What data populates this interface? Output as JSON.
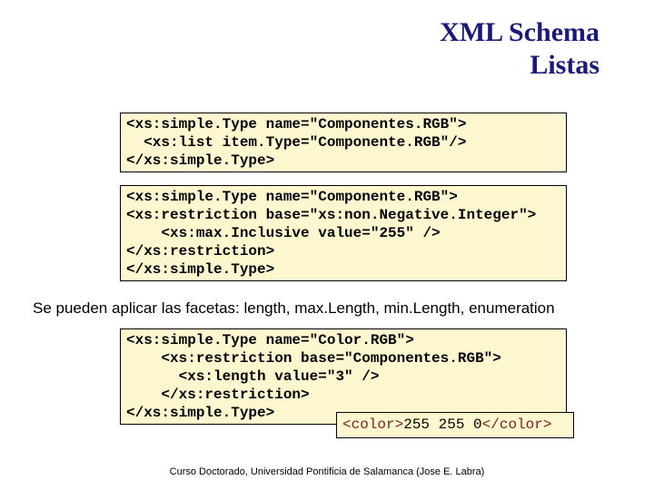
{
  "title_line1": "XML Schema",
  "title_line2": "Listas",
  "code1": "<xs:simple.Type name=\"Componentes.RGB\">\n  <xs:list item.Type=\"Componente.RGB\"/>\n</xs:simple.Type>",
  "code2": "<xs:simple.Type name=\"Componente.RGB\">\n<xs:restriction base=\"xs:non.Negative.Integer\">\n    <xs:max.Inclusive value=\"255\" />\n</xs:restriction>\n</xs:simple.Type>",
  "facets_text": "Se pueden aplicar las facetas: length, max.Length, min.Length, enumeration",
  "code3": "<xs:simple.Type name=\"Color.RGB\">\n    <xs:restriction base=\"Componentes.RGB\">\n      <xs:length value=\"3\" />\n    </xs:restriction>\n</xs:simple.Type>",
  "example_open": "<color>",
  "example_value": "255 255 0",
  "example_close": "</color>",
  "footer_text": "Curso Doctorado, Universidad Pontificia de Salamanca (Jose E. Labra)"
}
